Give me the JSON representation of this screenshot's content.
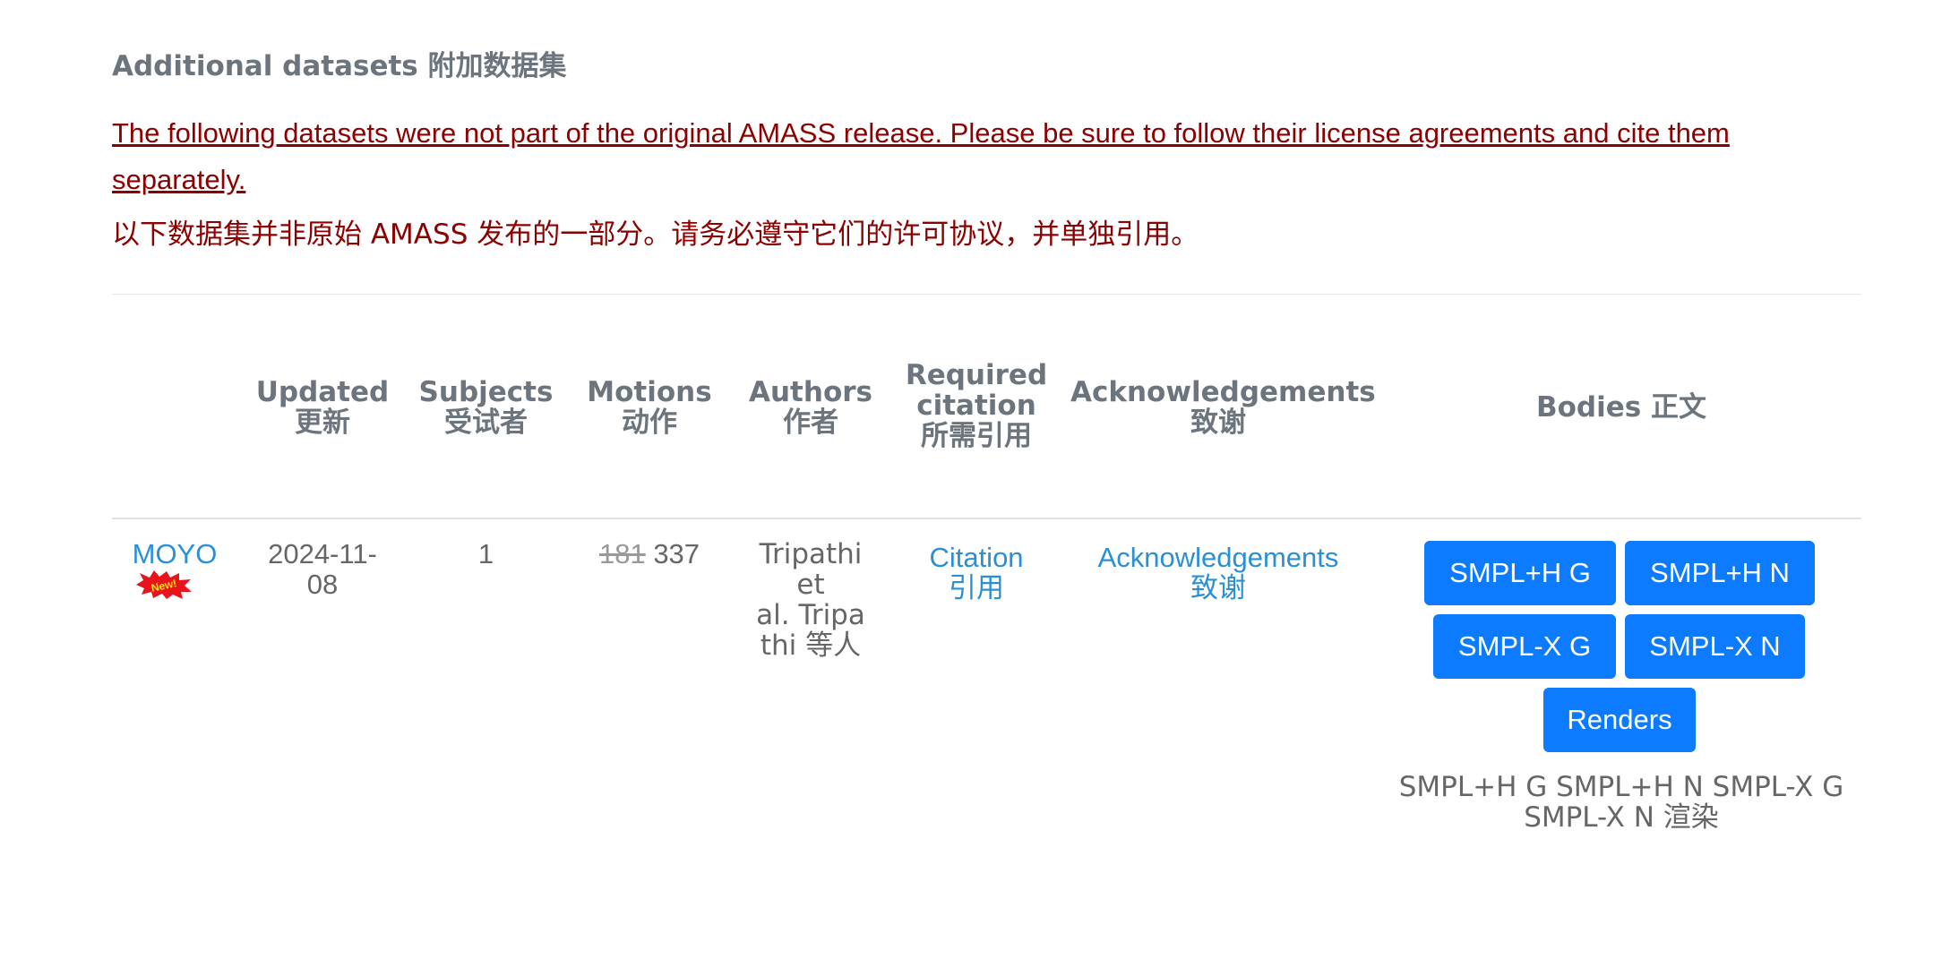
{
  "section": {
    "title": "Additional datasets 附加数据集",
    "notice_en": "The following datasets were not part of the original AMASS release. Please be sure to follow their license agreements and cite them separately.",
    "notice_zh": "以下数据集并非原始 AMASS 发布的一部分。请务必遵守它们的许可协议，并单独引用。"
  },
  "table": {
    "headers": {
      "updated_en": "Updated",
      "updated_zh": "更新",
      "subjects_en": "Subjects",
      "subjects_zh": "受试者",
      "motions_en": "Motions",
      "motions_zh": "动作",
      "authors_en": "Authors",
      "authors_zh": "作者",
      "citation_en1": "Required",
      "citation_en2": "citation",
      "citation_zh": "所需引用",
      "ack_en": "Acknowledgements",
      "ack_zh": "致谢",
      "bodies": "Bodies 正文"
    },
    "row": {
      "name": "MOYO",
      "badge": "New!",
      "updated_1": "2024-11-",
      "updated_2": "08",
      "subjects": "1",
      "motions_old": "181",
      "motions_new": "337",
      "authors_1": "Tripathi",
      "authors_2": "et",
      "authors_3": "al. Tripa",
      "authors_4": "thi 等人",
      "citation_en": "Citation",
      "citation_zh": "引用",
      "ack_en": "Acknowledgements",
      "ack_zh": "致谢",
      "buttons": {
        "smplh_g": "SMPL+H G",
        "smplh_n": "SMPL+H N",
        "smplx_g": "SMPL-X G",
        "smplx_n": "SMPL-X N",
        "renders": "Renders"
      },
      "bodies_text_1": "SMPL+H G SMPL+H N SMPL-X G",
      "bodies_text_2": "SMPL-X N 渲染"
    }
  },
  "colors": {
    "notice": "#8b0000",
    "link": "#2b8fd6",
    "button": "#0d7bff"
  }
}
